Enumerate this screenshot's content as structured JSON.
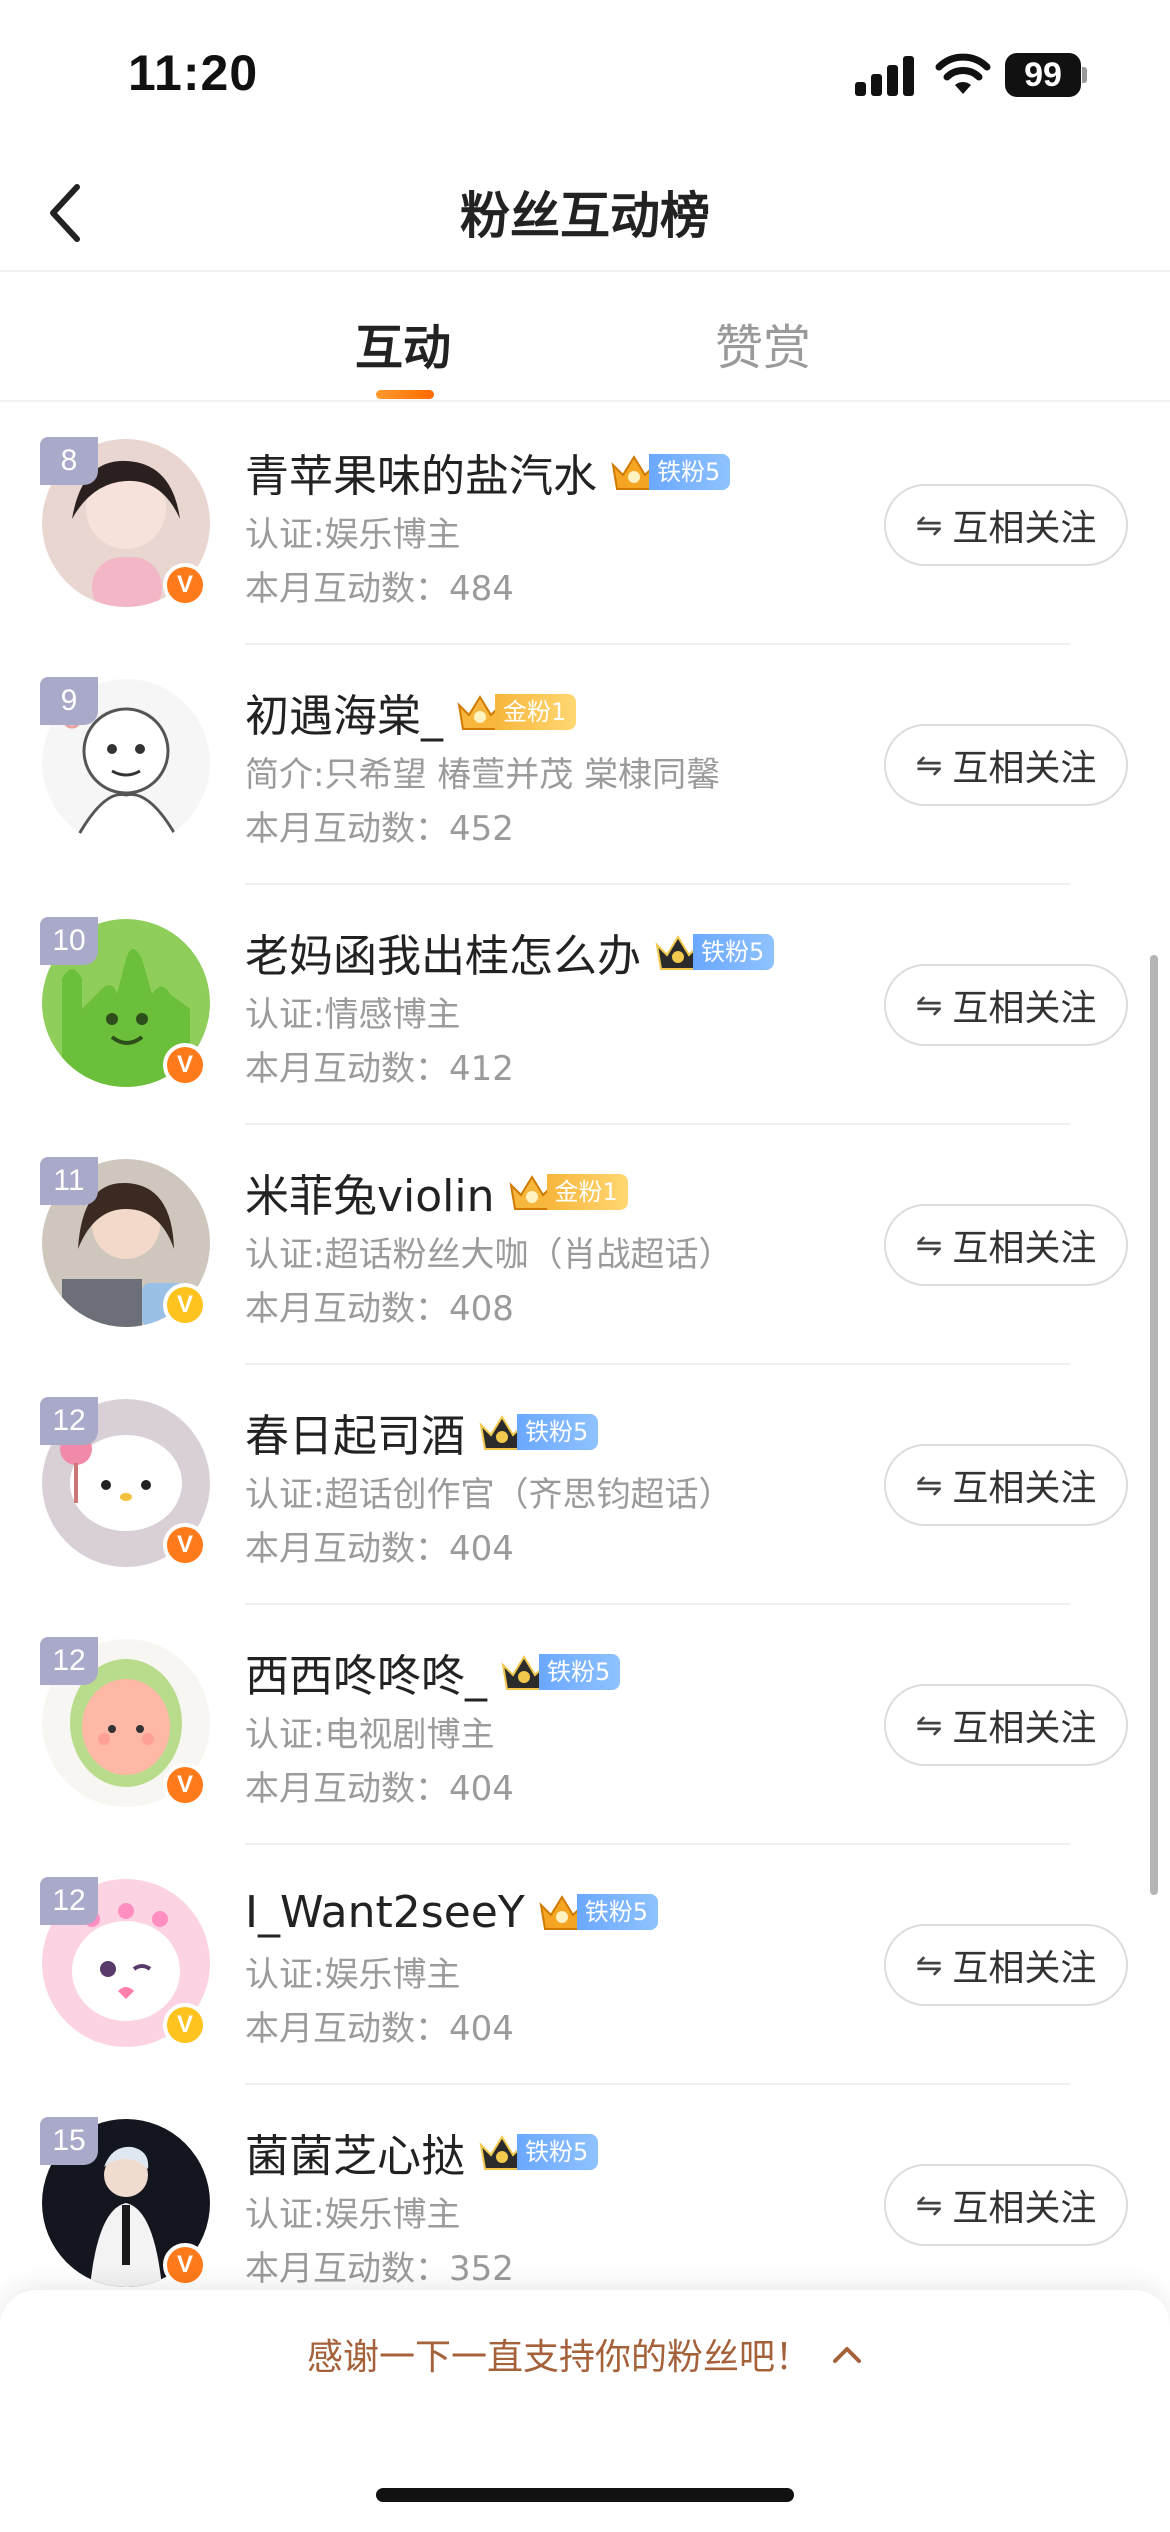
{
  "status_bar": {
    "time": "11:20",
    "battery": "99"
  },
  "nav": {
    "title": "粉丝互动榜"
  },
  "tabs": [
    {
      "label": "互动",
      "active": true
    },
    {
      "label": "赞赏",
      "active": false
    }
  ],
  "follow_button": {
    "icon": "⇋",
    "label": "互相关注"
  },
  "rows": [
    {
      "rank": "8",
      "name": "青苹果味的盐汽水",
      "badge": "铁粉5",
      "badge_type": "iron",
      "desc": "认证:娱乐博主",
      "count": "本月互动数：484",
      "verify": "orange"
    },
    {
      "rank": "9",
      "name": "初遇海棠_",
      "badge": "金粉1",
      "badge_type": "gold",
      "desc": "简介:只希望 椿萱并茂 棠棣同馨",
      "count": "本月互动数：452",
      "verify": ""
    },
    {
      "rank": "10",
      "name": "老妈函我出桂怎么办",
      "badge": "铁粉5",
      "badge_type": "iron",
      "desc": "认证:情感博主",
      "count": "本月互动数：412",
      "verify": "orange"
    },
    {
      "rank": "11",
      "name": "米菲兔violin",
      "badge": "金粉1",
      "badge_type": "gold",
      "desc": "认证:超话粉丝大咖（肖战超话）",
      "count": "本月互动数：408",
      "verify": "yellow"
    },
    {
      "rank": "12",
      "name": "春日起司酒",
      "badge": "铁粉5",
      "badge_type": "iron",
      "desc": "认证:超话创作官（齐思钧超话）",
      "count": "本月互动数：404",
      "verify": "orange"
    },
    {
      "rank": "12",
      "name": "西西咚咚咚_",
      "badge": "铁粉5",
      "badge_type": "iron",
      "desc": "认证:电视剧博主",
      "count": "本月互动数：404",
      "verify": "orange"
    },
    {
      "rank": "12",
      "name": "I_Want2seeY",
      "badge": "铁粉5",
      "badge_type": "iron",
      "desc": "认证:娱乐博主",
      "count": "本月互动数：404",
      "verify": "yellow"
    },
    {
      "rank": "15",
      "name": "菌菌芝心挞",
      "badge": "铁粉5",
      "badge_type": "iron",
      "desc": "认证:娱乐博主",
      "count": "本月互动数：352",
      "verify": "orange"
    }
  ],
  "bottom_sheet": {
    "text": "感谢一下一直支持你的粉丝吧！"
  },
  "colors": {
    "accent": "#ff7a1a",
    "iron_badge": "#6aa8ff",
    "gold_badge": "#f7b63c",
    "thanks_text": "#a4613a"
  }
}
